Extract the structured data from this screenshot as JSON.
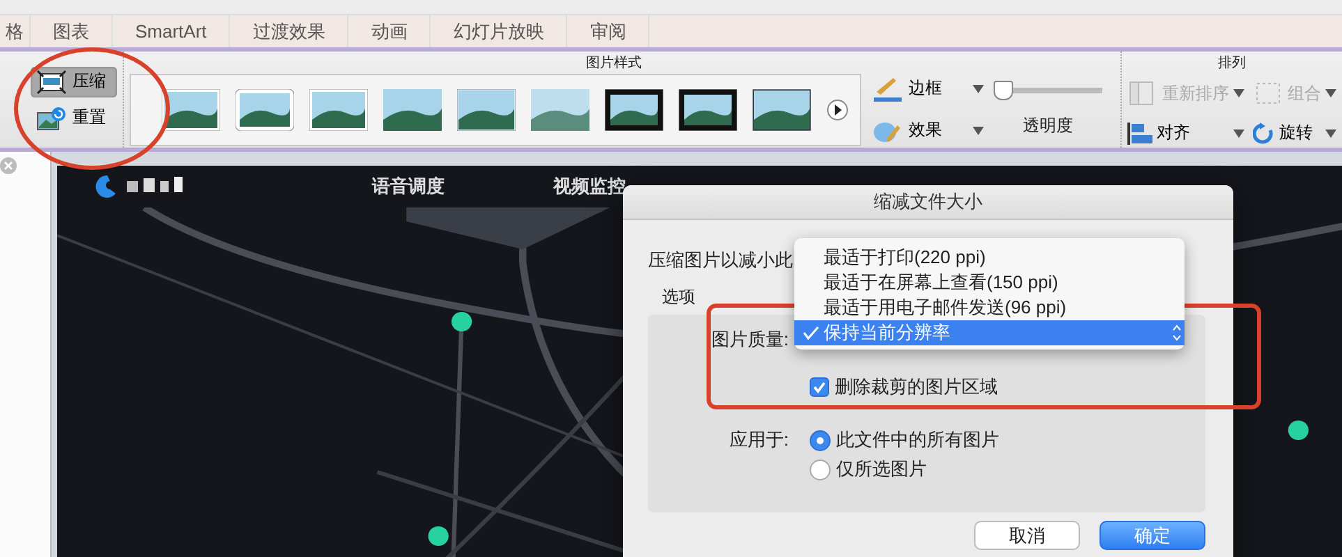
{
  "tabs": [
    {
      "label": "格"
    },
    {
      "label": "图表"
    },
    {
      "label": "SmartArt"
    },
    {
      "label": "过渡效果"
    },
    {
      "label": "动画"
    },
    {
      "label": "幻灯片放映"
    },
    {
      "label": "审阅"
    }
  ],
  "ribbon": {
    "adjust": [
      {
        "label": "压缩",
        "kind": "compress",
        "selected": true
      },
      {
        "label": "重置",
        "kind": "reset",
        "selected": false
      }
    ],
    "styles_title": "图片样式",
    "styles": [
      {
        "kind": "frame"
      },
      {
        "kind": "rounded"
      },
      {
        "kind": "frame"
      },
      {
        "kind": "shadow"
      },
      {
        "kind": "bevel"
      },
      {
        "kind": "soft"
      },
      {
        "kind": "black"
      },
      {
        "kind": "black"
      },
      {
        "kind": "dark"
      }
    ],
    "border": "边框",
    "effect": "效果",
    "transparency": {
      "label": "透明度",
      "level": 0
    },
    "arrange_title": "排列",
    "arrange": [
      {
        "label": "重新排序",
        "kind": "reorder",
        "disabled": true
      },
      {
        "label": "组合",
        "kind": "group",
        "disabled": true
      },
      {
        "label": "对齐",
        "kind": "align",
        "disabled": false
      },
      {
        "label": "旋转",
        "kind": "rotate",
        "disabled": false
      }
    ]
  },
  "slide": {
    "nav": [
      "语音调度",
      "视频监控"
    ]
  },
  "dialog": {
    "title": "缩减文件大小",
    "intro": "压缩图片以减小此",
    "options_label": "选项",
    "quality_label": "图片质量:",
    "quality_options": [
      {
        "label": "最适于打印(220 ppi)",
        "selected": false
      },
      {
        "label": "最适于在屏幕上查看(150 ppi)",
        "selected": false
      },
      {
        "label": "最适于用电子邮件发送(96 ppi)",
        "selected": false
      },
      {
        "label": "保持当前分辨率",
        "selected": true
      }
    ],
    "delete_cropped": {
      "label": "删除裁剪的图片区域",
      "checked": true
    },
    "apply_label": "应用于:",
    "apply_options": [
      {
        "label": "此文件中的所有图片",
        "selected": true
      },
      {
        "label": "仅所选图片",
        "selected": false
      }
    ],
    "buttons": [
      {
        "label": "取消",
        "kind": "secondary"
      },
      {
        "label": "确定",
        "kind": "primary"
      }
    ]
  }
}
